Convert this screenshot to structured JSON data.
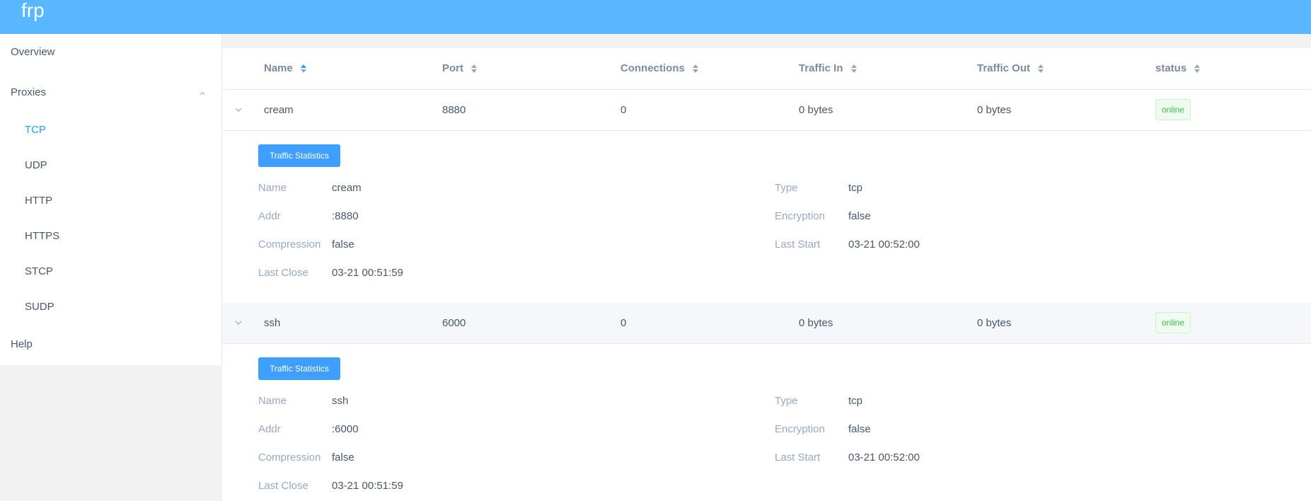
{
  "header": {
    "brand": "frp"
  },
  "sidebar": {
    "overview": "Overview",
    "proxies": "Proxies",
    "proxy_types": [
      "TCP",
      "UDP",
      "HTTP",
      "HTTPS",
      "STCP",
      "SUDP"
    ],
    "help": "Help"
  },
  "table": {
    "columns": [
      "Name",
      "Port",
      "Connections",
      "Traffic In",
      "Traffic Out",
      "status"
    ],
    "rows": [
      {
        "name": "cream",
        "port": "8880",
        "connections": "0",
        "traffic_in": "0 bytes",
        "traffic_out": "0 bytes",
        "status": "online",
        "detail": {
          "button": "Traffic Statistics",
          "name_label": "Name",
          "name": "cream",
          "type_label": "Type",
          "type": "tcp",
          "addr_label": "Addr",
          "addr": ":8880",
          "encryption_label": "Encryption",
          "encryption": "false",
          "compression_label": "Compression",
          "compression": "false",
          "last_start_label": "Last Start",
          "last_start": "03-21 00:52:00",
          "last_close_label": "Last Close",
          "last_close": "03-21 00:51:59"
        }
      },
      {
        "name": "ssh",
        "port": "6000",
        "connections": "0",
        "traffic_in": "0 bytes",
        "traffic_out": "0 bytes",
        "status": "online",
        "detail": {
          "button": "Traffic Statistics",
          "name_label": "Name",
          "name": "ssh",
          "type_label": "Type",
          "type": "tcp",
          "addr_label": "Addr",
          "addr": ":6000",
          "encryption_label": "Encryption",
          "encryption": "false",
          "compression_label": "Compression",
          "compression": "false",
          "last_start_label": "Last Start",
          "last_start": "03-21 00:52:00",
          "last_close_label": "Last Close",
          "last_close": "03-21 00:51:59"
        }
      }
    ]
  },
  "colors": {
    "header_bg": "#58b7ff",
    "accent": "#20a0ff",
    "button_bg": "#3f9fff",
    "online_text": "#3cbd4a"
  }
}
